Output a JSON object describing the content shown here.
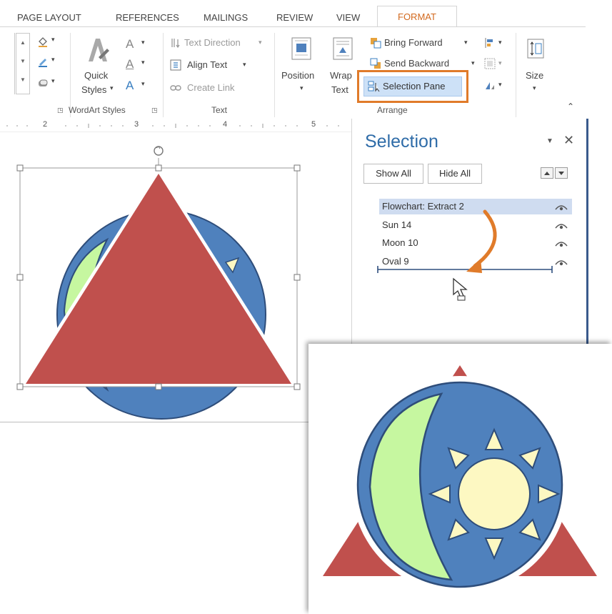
{
  "ribbon": {
    "tabs": [
      "PAGE LAYOUT",
      "REFERENCES",
      "MAILINGS",
      "REVIEW",
      "VIEW"
    ],
    "active_tab": "FORMAT",
    "wordart": {
      "quick_styles_line1": "Quick",
      "quick_styles_line2": "Styles",
      "group_label": "WordArt Styles"
    },
    "text_group": {
      "text_direction": "Text Direction",
      "align_text": "Align Text",
      "create_link": "Create Link",
      "group_label": "Text"
    },
    "arrange_group": {
      "position": "Position",
      "wrap_line1": "Wrap",
      "wrap_line2": "Text",
      "bring_forward": "Bring Forward",
      "send_backward": "Send Backward",
      "selection_pane": "Selection Pane",
      "group_label": "Arrange"
    },
    "size_group": {
      "size": "Size"
    }
  },
  "ruler": {
    "marks": [
      "2",
      "3",
      "4",
      "5"
    ]
  },
  "selection_pane": {
    "title": "Selection",
    "show_all": "Show All",
    "hide_all": "Hide All",
    "items": [
      "Flowchart: Extract 2",
      "Sun 14",
      "Moon 10",
      "Oval 9"
    ]
  },
  "colors": {
    "accent_orange": "#e07b2a",
    "triangle_red": "#c0504d",
    "circle_blue": "#4f81bd",
    "moon_green": "#c6f7a0",
    "sun_yellow": "#fdf8c2",
    "pane_title_blue": "#2f6ca8"
  },
  "icons": [
    "rotate-handle-icon",
    "close-icon",
    "eye-icon",
    "move-up-icon",
    "move-down-icon",
    "pointer-cursor-icon",
    "curved-arrow-icon"
  ]
}
